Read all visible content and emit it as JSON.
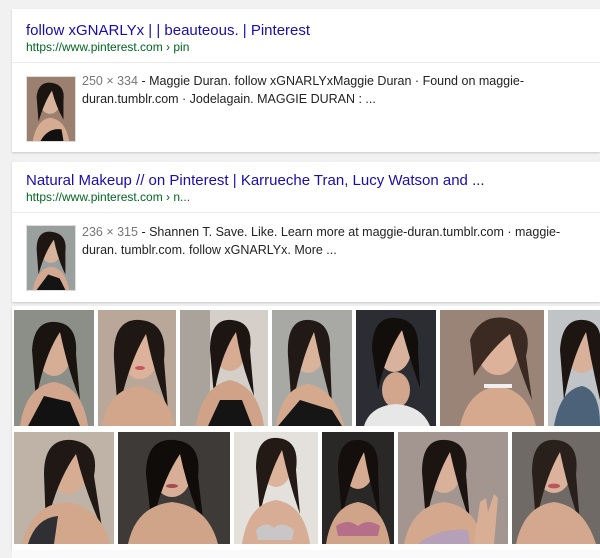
{
  "results": [
    {
      "title": "follow xGNARLYx | | beauteous. | Pinterest",
      "url": "https://www.pinterest.com › pin",
      "dims": "250 × 334",
      "snippet": " - Maggie Duran. follow xGNARLYxMaggie Duran · Found on maggie-duran.tumblr.com · Jodelagain. MAGGIE DURAN : ..."
    },
    {
      "title": "Natural Makeup // on Pinterest | Karrueche Tran, Lucy Watson and ...",
      "url": "https://www.pinterest.com › n...",
      "dims": "236 × 315",
      "snippet": " - Shannen T. Save. Like. Learn more at maggie-duran.tumblr.com · maggie-duran. tumblr.com. follow xGNARLYx. More ..."
    }
  ],
  "colors": {
    "link": "#1a0dab",
    "url": "#006621",
    "snippet": "#222222",
    "page_bg": "#f1f1f1"
  },
  "image_grid": {
    "row1_count": 7,
    "row2_count": 6
  }
}
